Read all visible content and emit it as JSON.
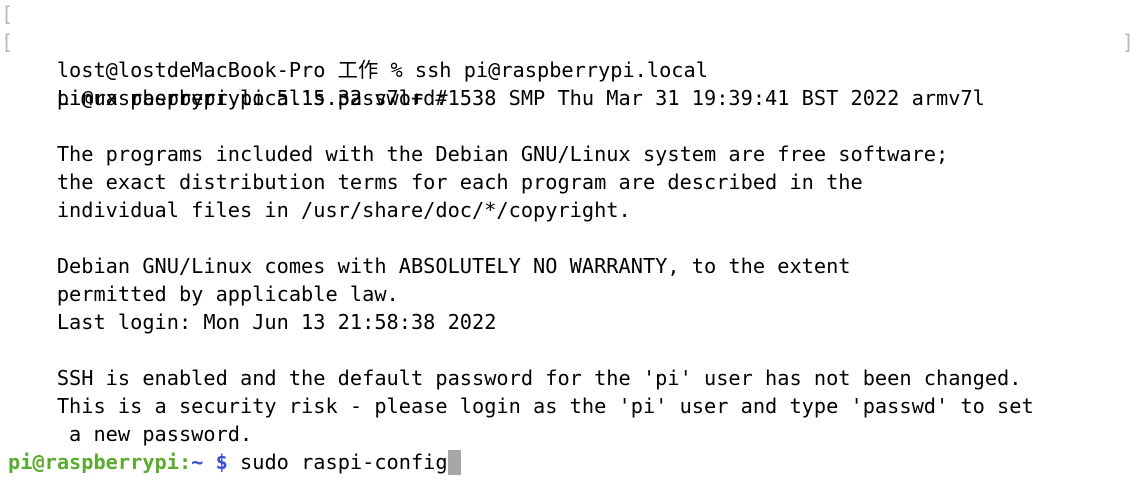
{
  "terminal": {
    "lines": [
      "lost@lostdeMacBook-Pro 工作 % ssh pi@raspberrypi.local",
      "pi@raspberrypi.local's password:",
      "Linux raspberrypi 5.15.32-v7l+ #1538 SMP Thu Mar 31 19:39:41 BST 2022 armv7l",
      "",
      "The programs included with the Debian GNU/Linux system are free software;",
      "the exact distribution terms for each program are described in the",
      "individual files in /usr/share/doc/*/copyright.",
      "",
      "Debian GNU/Linux comes with ABSOLUTELY NO WARRANTY, to the extent",
      "permitted by applicable law.",
      "Last login: Mon Jun 13 21:58:38 2022",
      "",
      "SSH is enabled and the default password for the 'pi' user has not been changed.",
      "This is a security risk - please login as the 'pi' user and type 'passwd' to set",
      " a new password.",
      ""
    ],
    "prompt": {
      "user_host": "pi@raspberrypi",
      "separator": ":",
      "path": "~",
      "symbol": " $",
      "command": " sudo raspi-config"
    },
    "markers": {
      "left": "[",
      "right": "]"
    },
    "colors": {
      "user_host": "#5bab2e",
      "path": "#3a4fd0",
      "cursor": "#a7a7a7"
    }
  }
}
